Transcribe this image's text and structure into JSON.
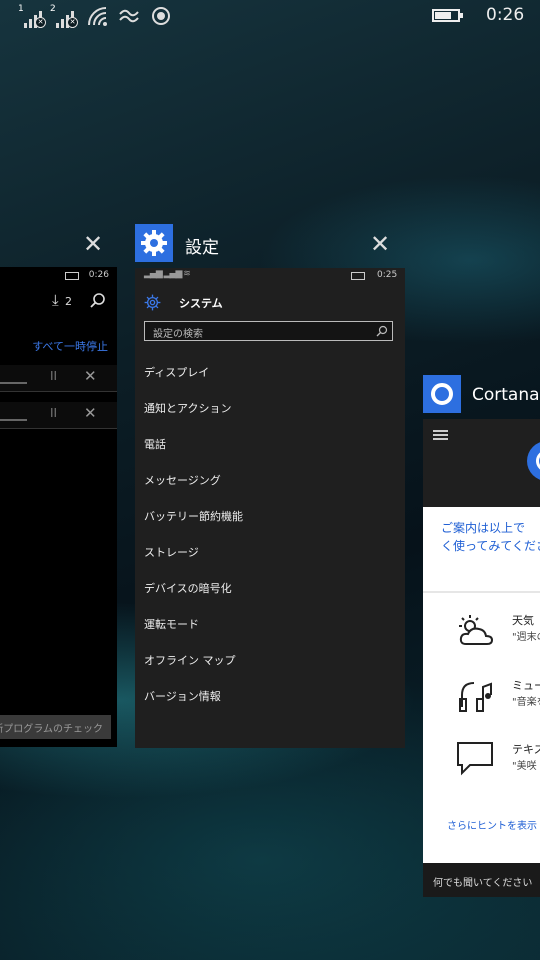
{
  "status_bar": {
    "sim1": "1",
    "sim2": "2",
    "time": "0:26"
  },
  "left_card": {
    "status_time": "0:26",
    "download_count": "2",
    "pause_all": "すべて一時停止",
    "check_updates_button": "更新プログラムのチェック"
  },
  "settings_card": {
    "title": "設定",
    "status_time": "0:25",
    "header": "システム",
    "search_placeholder": "設定の検索",
    "items": [
      "ディスプレイ",
      "通知とアクション",
      "電話",
      "メッセージング",
      "バッテリー節約機能",
      "ストレージ",
      "デバイスの暗号化",
      "運転モード",
      "オフライン マップ",
      "バージョン情報"
    ]
  },
  "cortana_card": {
    "title": "Cortana",
    "message_line1": "ご案内は以上で",
    "message_line2": "く使ってみてくださ",
    "suggestions": [
      {
        "title": "天気",
        "sub": "\"週末の"
      },
      {
        "title": "ミュージ",
        "sub": "\"音楽を"
      },
      {
        "title": "テキスト",
        "sub": "\"美咲"
      }
    ],
    "more_hints": "さらにヒントを表示",
    "ask_box": "何でも聞いてください"
  },
  "colors": {
    "accent": "#2d6fe0",
    "cortana_link": "#1f5fd4"
  }
}
